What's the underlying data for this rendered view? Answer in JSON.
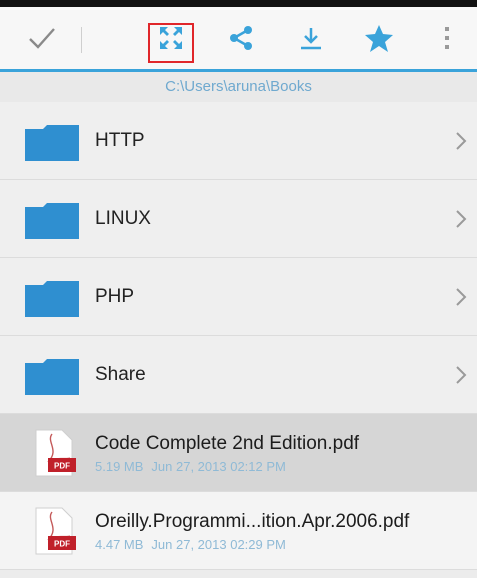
{
  "colors": {
    "accent": "#3aa3da",
    "folder": "#2f8fd0",
    "highlight_box": "#e0262a",
    "pdf_badge": "#c0202a"
  },
  "toolbar": {
    "icons": [
      "checkmark-icon",
      "expand-icon",
      "share-icon",
      "download-icon",
      "star-icon",
      "overflow-menu-icon"
    ]
  },
  "path": "C:\\Users\\aruna\\Books",
  "folders": [
    {
      "label": "HTTP"
    },
    {
      "label": "LINUX"
    },
    {
      "label": "PHP"
    },
    {
      "label": "Share"
    }
  ],
  "files": [
    {
      "name": "Code Complete 2nd Edition.pdf",
      "size": "5.19 MB",
      "date": "Jun 27, 2013 02:12 PM",
      "badge": "PDF",
      "selected": true
    },
    {
      "name": "Oreilly.Programmi...ition.Apr.2006.pdf",
      "size": "4.47 MB",
      "date": "Jun 27, 2013 02:29 PM",
      "badge": "PDF",
      "selected": false
    }
  ]
}
